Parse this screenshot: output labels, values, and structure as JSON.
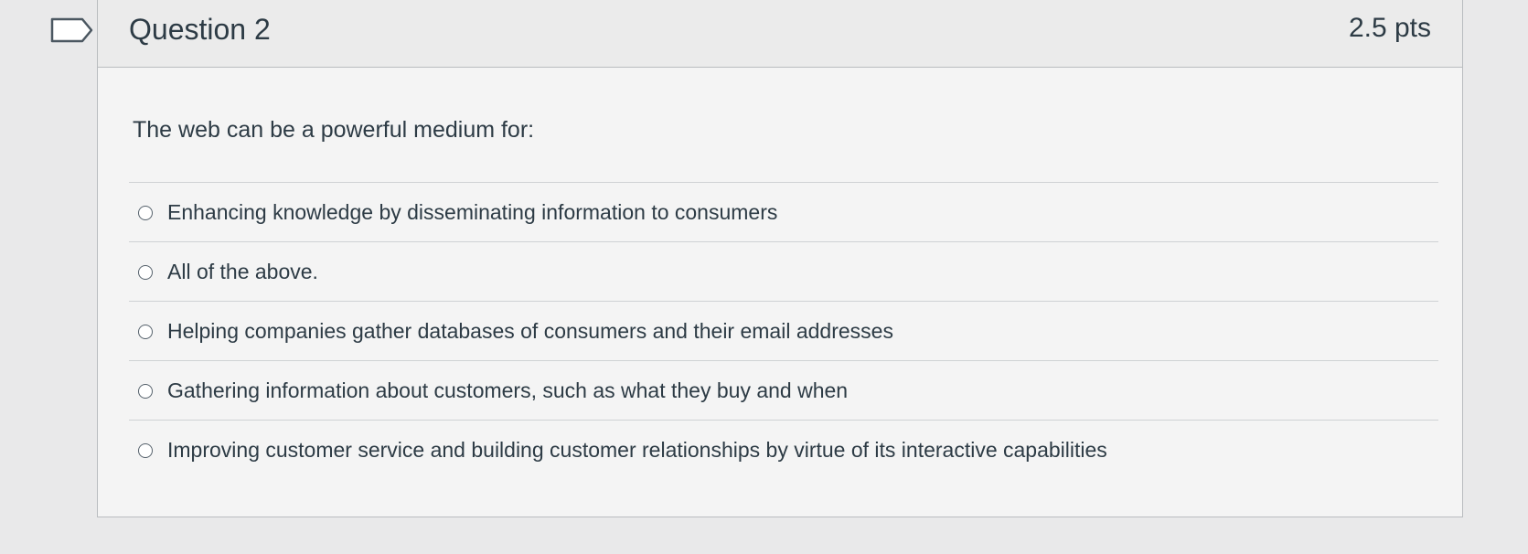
{
  "question": {
    "title": "Question 2",
    "points": "2.5 pts",
    "text": "The web can be a powerful medium for:",
    "flag_icon": "bookmark-flag-icon",
    "answers": [
      {
        "label": "Enhancing knowledge by disseminating information to consumers",
        "selected": false
      },
      {
        "label": "All of the above.",
        "selected": false
      },
      {
        "label": "Helping companies gather databases of consumers and their email addresses",
        "selected": false
      },
      {
        "label": "Gathering information about customers, such as what they buy and when",
        "selected": false
      },
      {
        "label": "Improving customer service and building customer relationships by virtue of its interactive capabilities",
        "selected": false
      }
    ]
  }
}
